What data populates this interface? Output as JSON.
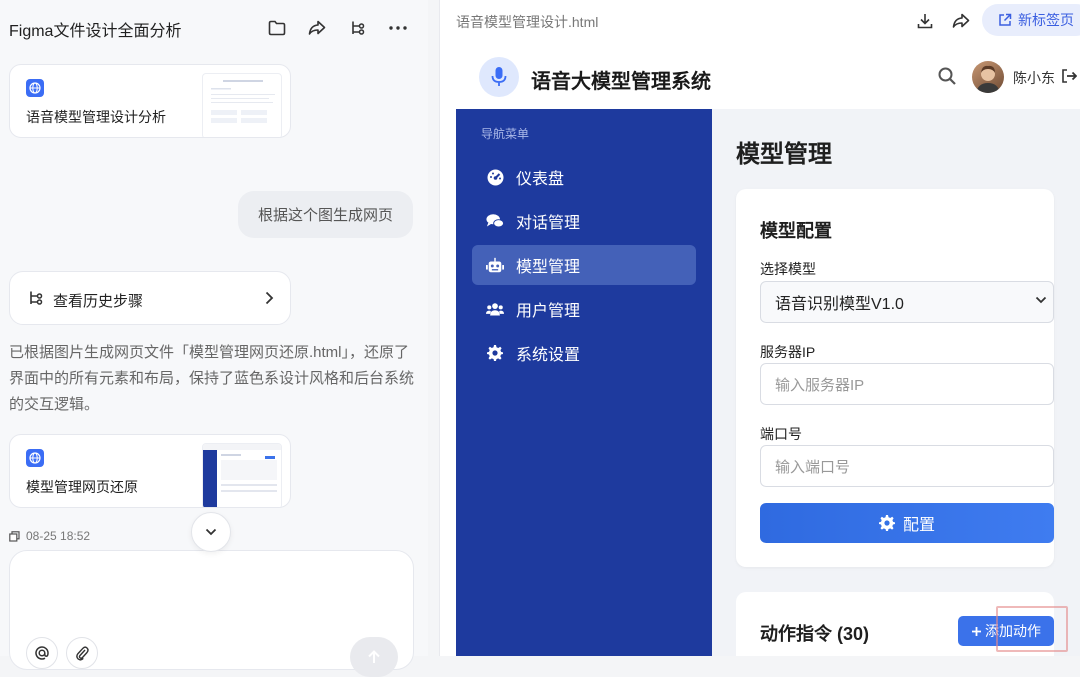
{
  "chat": {
    "title": "Figma文件设计全面分析",
    "file_card_1": {
      "name": "语音模型管理设计分析",
      "icon": "globe-icon"
    },
    "user_message": "根据这个图生成网页",
    "history": {
      "label": "查看历史步骤"
    },
    "ai_message": "已根据图片生成网页文件「模型管理网页还原.html」，还原了界面中的所有元素和布局，保持了蓝色系设计风格和后台系统的交互逻辑。",
    "file_card_2": {
      "name": "模型管理网页还原",
      "icon": "globe-icon"
    },
    "timestamp": "08-25 18:52"
  },
  "preview": {
    "file_name": "语音模型管理设计.html",
    "new_tab_label": "新标签页",
    "app": {
      "title": "语音大模型管理系统",
      "user_name": "陈小东",
      "nav_caption": "导航菜单",
      "nav_items": [
        {
          "label": "仪表盘",
          "icon": "dashboard-icon"
        },
        {
          "label": "对话管理",
          "icon": "comments-icon"
        },
        {
          "label": "模型管理",
          "icon": "robot-icon",
          "active": true
        },
        {
          "label": "用户管理",
          "icon": "users-icon"
        },
        {
          "label": "系统设置",
          "icon": "gear-icon"
        }
      ],
      "page_title": "模型管理",
      "config": {
        "title": "模型配置",
        "model_label": "选择模型",
        "model_value": "语音识别模型V1.0",
        "server_label": "服务器IP",
        "server_placeholder": "输入服务器IP",
        "port_label": "端口号",
        "port_placeholder": "输入端口号",
        "submit_label": "配置"
      },
      "actions": {
        "title": "动作指令 (30)",
        "add_label": "添加动作"
      }
    }
  },
  "colors": {
    "sidebar": "#1e3a9e",
    "sidebar_active": "#4461b8",
    "primary": "#3b72ea",
    "new_tab_bg": "#e8edfc"
  }
}
